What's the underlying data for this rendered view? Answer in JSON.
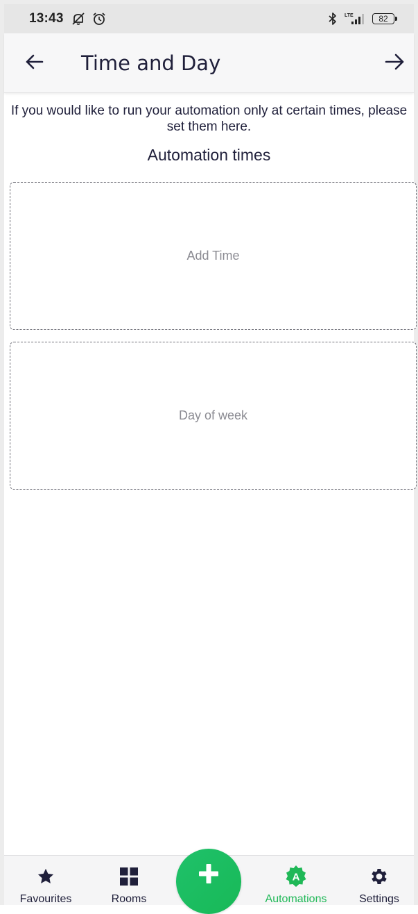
{
  "status_bar": {
    "time": "13:43",
    "battery": "82",
    "icons": [
      "notifications-off-icon",
      "alarm-icon",
      "bluetooth-icon",
      "lte-signal-icon",
      "battery-icon"
    ],
    "network": "LTE"
  },
  "header": {
    "title": "Time and Day",
    "back_icon": "arrow-left-icon",
    "next_icon": "arrow-right-icon"
  },
  "main": {
    "intro": "If you would like to run your automation only at certain times, please set them here.",
    "section_title": "Automation times",
    "cards": [
      {
        "label": "Add Time"
      },
      {
        "label": "Day of week"
      }
    ]
  },
  "bottom_nav": {
    "items": [
      {
        "label": "Favourites",
        "icon": "star-icon",
        "active": false
      },
      {
        "label": "Rooms",
        "icon": "grid-icon",
        "active": false
      },
      {
        "label": "Automations",
        "icon": "automation-badge-icon",
        "active": true
      },
      {
        "label": "Settings",
        "icon": "gear-icon",
        "active": false
      }
    ],
    "fab_icon": "plus-icon",
    "automation_badge_letter": "A"
  },
  "colors": {
    "accent": "#1fb857",
    "text_primary": "#1f1f3a",
    "text_muted": "#8b8b92",
    "header_bg": "#f7f7f8",
    "status_bg": "#e6e6e6"
  }
}
